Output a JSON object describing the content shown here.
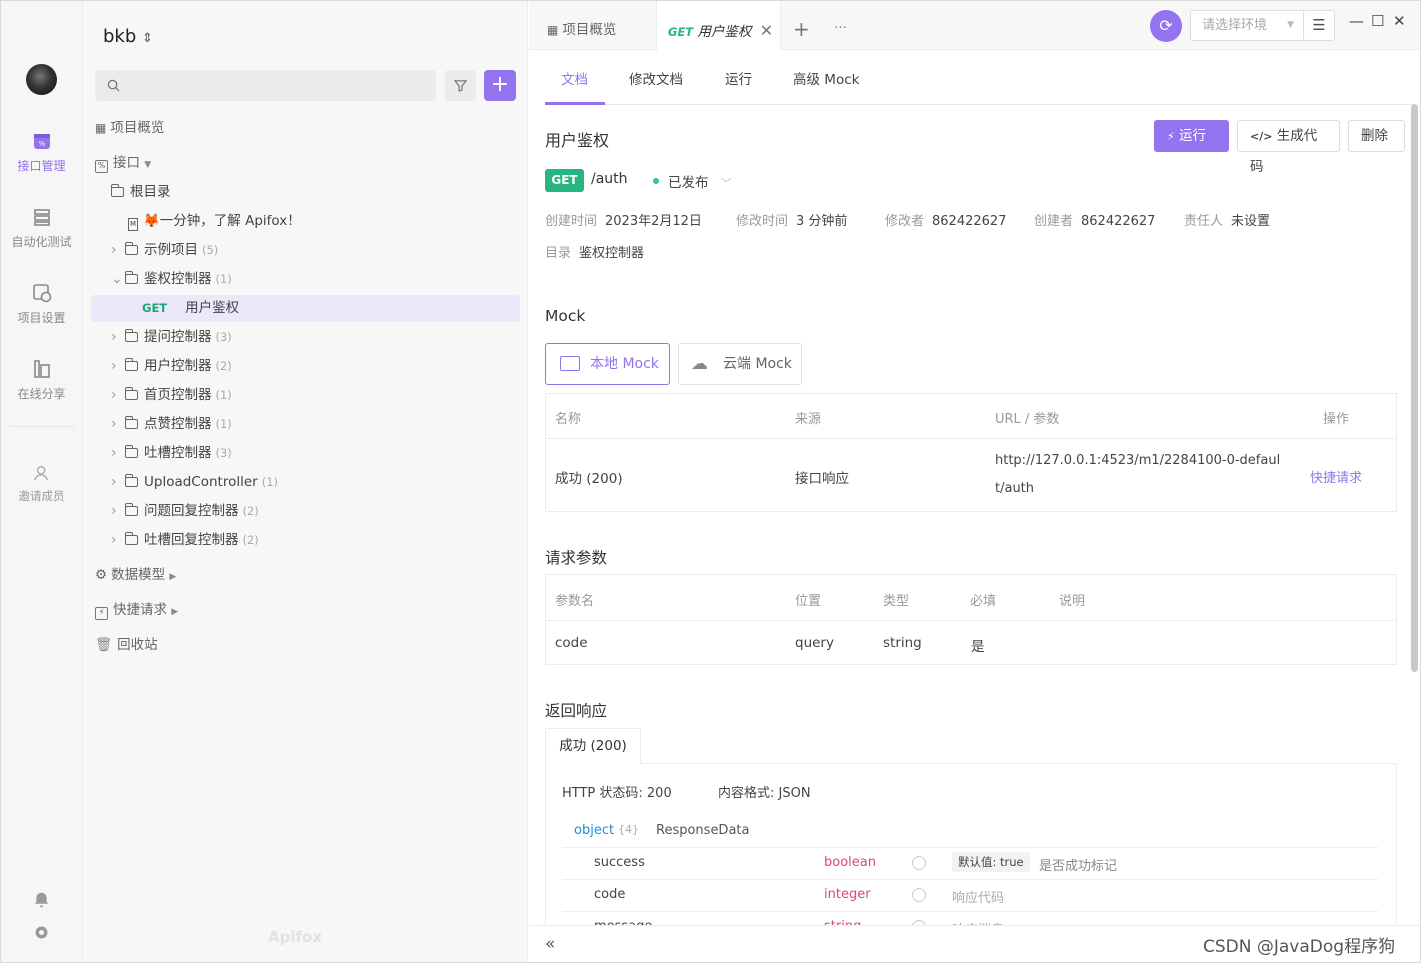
{
  "rail": {
    "items": [
      {
        "label": "接口管理",
        "icon": "api-icon"
      },
      {
        "label": "自动化测试",
        "icon": "automation-icon"
      },
      {
        "label": "项目设置",
        "icon": "settings-icon"
      },
      {
        "label": "在线分享",
        "icon": "share-icon"
      },
      {
        "label": "邀请成员",
        "icon": "invite-icon"
      }
    ]
  },
  "tree": {
    "project": "bkb",
    "overview": "项目概览",
    "interfaces": "接口",
    "root": "根目录",
    "intro": "🦊一分钟，了解 Apifox！",
    "folders": [
      {
        "name": "示例项目",
        "count": "(5)"
      },
      {
        "name": "鉴权控制器",
        "count": "(1)"
      },
      {
        "name": "提问控制器",
        "count": "(3)"
      },
      {
        "name": "用户控制器",
        "count": "(2)"
      },
      {
        "name": "首页控制器",
        "count": "(1)"
      },
      {
        "name": "点赞控制器",
        "count": "(1)"
      },
      {
        "name": "吐槽控制器",
        "count": "(3)"
      },
      {
        "name": "UploadController",
        "count": "(1)"
      },
      {
        "name": "问题回复控制器",
        "count": "(2)"
      },
      {
        "name": "吐槽回复控制器",
        "count": "(2)"
      }
    ],
    "selected": {
      "method": "GET",
      "name": "用户鉴权"
    },
    "data_model": "数据模型",
    "quick_request": "快捷请求",
    "trash": "回收站",
    "brand": "Apifox"
  },
  "topbar": {
    "tab1": "项目概览",
    "tab2_method": "GET",
    "tab2_name": "用户鉴权",
    "env_placeholder": "请选择环境"
  },
  "subtabs": [
    "文档",
    "修改文档",
    "运行",
    "高级 Mock"
  ],
  "api": {
    "title": "用户鉴权",
    "run": "运行",
    "gencode": "生成代码",
    "delete": "删除",
    "method": "GET",
    "path": "/auth",
    "status": "已发布",
    "meta": [
      {
        "k": "创建时间",
        "v": "2023年2月12日"
      },
      {
        "k": "修改时间",
        "v": "3 分钟前"
      },
      {
        "k": "修改者",
        "v": "862422627"
      },
      {
        "k": "创建者",
        "v": "862422627"
      },
      {
        "k": "责任人",
        "v": "未设置"
      }
    ],
    "dir_label": "目录",
    "dir_value": "鉴权控制器"
  },
  "mock": {
    "title": "Mock",
    "local": "本地 Mock",
    "cloud": "云端 Mock",
    "headers": [
      "名称",
      "来源",
      "URL / 参数",
      "操作"
    ],
    "row": {
      "name": "成功 (200)",
      "source": "接口响应",
      "url1": "http://127.0.0.1:4523/m1/2284100-0-defaul",
      "url2": "t/auth",
      "action": "快捷请求"
    }
  },
  "params": {
    "title": "请求参数",
    "headers": [
      "参数名",
      "位置",
      "类型",
      "必填",
      "说明"
    ],
    "row": {
      "name": "code",
      "pos": "query",
      "type": "string",
      "req": "是"
    }
  },
  "response": {
    "title": "返回响应",
    "tab": "成功 (200)",
    "http_status": "HTTP 状态码: 200",
    "content_type": "内容格式: JSON",
    "root_type": "object",
    "root_count": "{4}",
    "root_name": "ResponseData",
    "fields": [
      {
        "name": "success",
        "type": "boolean",
        "default_label": "默认值:",
        "default_value": "true",
        "desc": "是否成功标记"
      },
      {
        "name": "code",
        "type": "integer",
        "desc": "响应代码"
      },
      {
        "name": "message",
        "type": "string",
        "desc": "响应消息"
      }
    ]
  },
  "watermark": "CSDN @JavaDog程序狗",
  "colors": {
    "accent": "#9373ee",
    "get": "#27b680",
    "type": "#e0457b"
  }
}
